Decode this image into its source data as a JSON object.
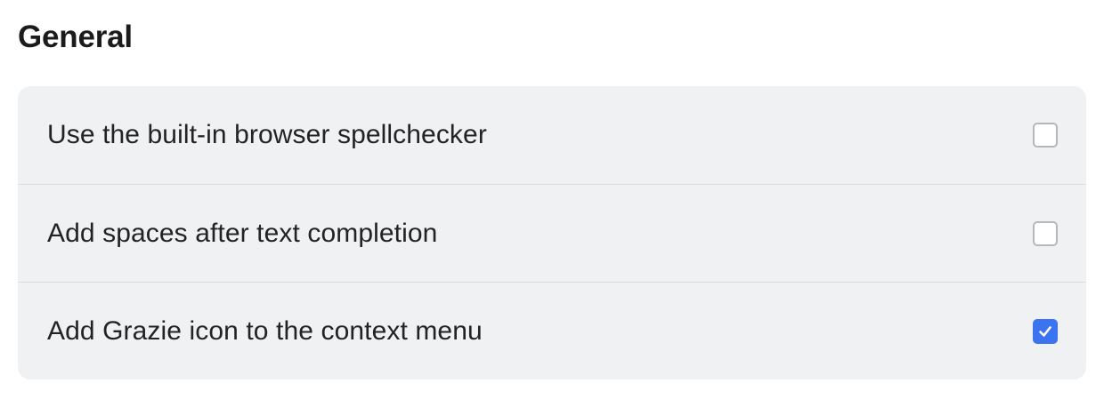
{
  "section": {
    "title": "General"
  },
  "settings": [
    {
      "label": "Use the built-in browser spellchecker",
      "checked": false
    },
    {
      "label": "Add spaces after text completion",
      "checked": false
    },
    {
      "label": "Add Grazie icon to the context menu",
      "checked": true
    }
  ],
  "colors": {
    "accent": "#3b73f0",
    "card_background": "#f0f1f3",
    "checkbox_border": "#b6b7bd"
  },
  "icons": {
    "check": "checkmark-icon"
  }
}
